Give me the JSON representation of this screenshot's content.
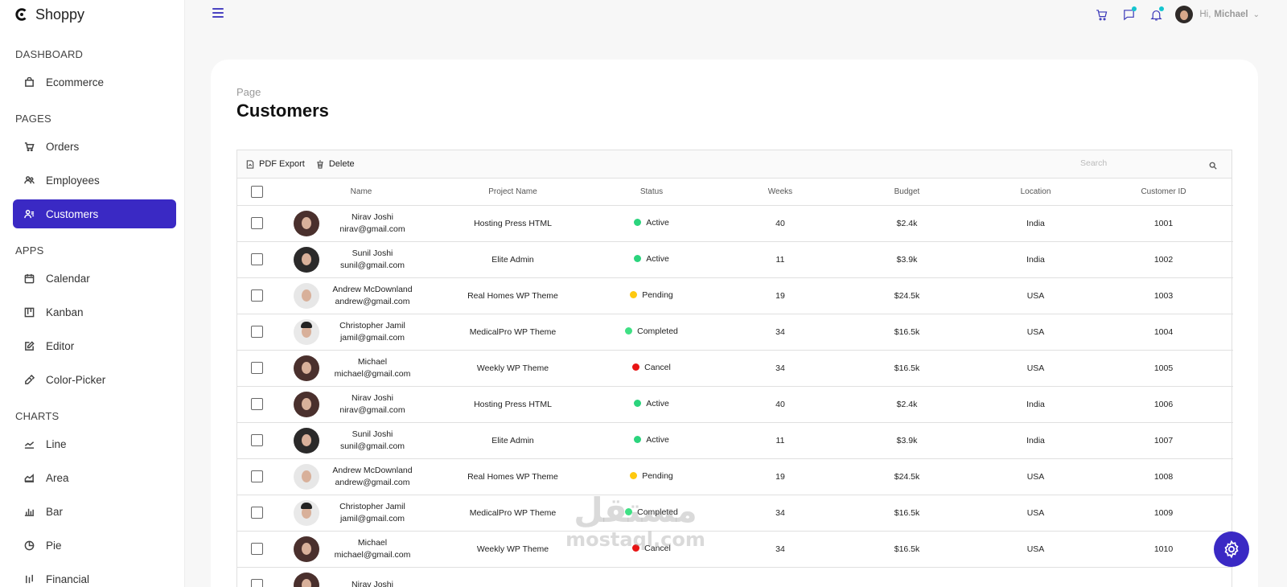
{
  "app": {
    "name": "Shoppy"
  },
  "sidebar": {
    "sections": [
      {
        "title": "DASHBOARD",
        "items": [
          {
            "label": "Ecommerce",
            "icon": "shopping-bag-icon"
          }
        ]
      },
      {
        "title": "PAGES",
        "items": [
          {
            "label": "Orders",
            "icon": "cart-icon"
          },
          {
            "label": "Employees",
            "icon": "employees-icon"
          },
          {
            "label": "Customers",
            "icon": "customers-icon",
            "active": true
          }
        ]
      },
      {
        "title": "APPS",
        "items": [
          {
            "label": "Calendar",
            "icon": "calendar-icon"
          },
          {
            "label": "Kanban",
            "icon": "kanban-icon"
          },
          {
            "label": "Editor",
            "icon": "edit-icon"
          },
          {
            "label": "Color-Picker",
            "icon": "color-picker-icon"
          }
        ]
      },
      {
        "title": "CHARTS",
        "items": [
          {
            "label": "Line",
            "icon": "line-chart-icon"
          },
          {
            "label": "Area",
            "icon": "area-chart-icon"
          },
          {
            "label": "Bar",
            "icon": "bar-chart-icon"
          },
          {
            "label": "Pie",
            "icon": "pie-chart-icon"
          },
          {
            "label": "Financial",
            "icon": "financial-icon"
          }
        ]
      }
    ]
  },
  "topbar": {
    "greeting": "Hi,",
    "user_name": "Michael",
    "accent": "#3a38b8",
    "notification_dot_color": "#14c5cf"
  },
  "page": {
    "subtitle": "Page",
    "title": "Customers"
  },
  "grid": {
    "toolbar": {
      "pdf_export": "PDF Export",
      "delete": "Delete"
    },
    "search": {
      "placeholder": "Search"
    },
    "columns": [
      "Name",
      "Project Name",
      "Status",
      "Weeks",
      "Budget",
      "Location",
      "Customer ID"
    ],
    "status_colors": {
      "Active": "#2bd47d",
      "Pending": "#fec90f",
      "Completed": "#3fe084",
      "Cancel": "#e81414"
    },
    "rows": [
      {
        "name": "Nirav Joshi",
        "email": "nirav@gmail.com",
        "project": "Hosting Press HTML",
        "status": "Active",
        "weeks": "40",
        "budget": "$2.4k",
        "location": "India",
        "id": "1001",
        "avatar": "av-a"
      },
      {
        "name": "Sunil Joshi",
        "email": "sunil@gmail.com",
        "project": "Elite Admin",
        "status": "Active",
        "weeks": "11",
        "budget": "$3.9k",
        "location": "India",
        "id": "1002",
        "avatar": "av-b"
      },
      {
        "name": "Andrew McDownland",
        "email": "andrew@gmail.com",
        "project": "Real Homes WP Theme",
        "status": "Pending",
        "weeks": "19",
        "budget": "$24.5k",
        "location": "USA",
        "id": "1003",
        "avatar": "av-c"
      },
      {
        "name": "Christopher Jamil",
        "email": "jamil@gmail.com",
        "project": "MedicalPro WP Theme",
        "status": "Completed",
        "weeks": "34",
        "budget": "$16.5k",
        "location": "USA",
        "id": "1004",
        "avatar": "av-d"
      },
      {
        "name": "Michael",
        "email": "michael@gmail.com",
        "project": "Weekly WP Theme",
        "status": "Cancel",
        "weeks": "34",
        "budget": "$16.5k",
        "location": "USA",
        "id": "1005",
        "avatar": "av-a"
      },
      {
        "name": "Nirav Joshi",
        "email": "nirav@gmail.com",
        "project": "Hosting Press HTML",
        "status": "Active",
        "weeks": "40",
        "budget": "$2.4k",
        "location": "India",
        "id": "1006",
        "avatar": "av-a"
      },
      {
        "name": "Sunil Joshi",
        "email": "sunil@gmail.com",
        "project": "Elite Admin",
        "status": "Active",
        "weeks": "11",
        "budget": "$3.9k",
        "location": "India",
        "id": "1007",
        "avatar": "av-b"
      },
      {
        "name": "Andrew McDownland",
        "email": "andrew@gmail.com",
        "project": "Real Homes WP Theme",
        "status": "Pending",
        "weeks": "19",
        "budget": "$24.5k",
        "location": "USA",
        "id": "1008",
        "avatar": "av-c"
      },
      {
        "name": "Christopher Jamil",
        "email": "jamil@gmail.com",
        "project": "MedicalPro WP Theme",
        "status": "Completed",
        "weeks": "34",
        "budget": "$16.5k",
        "location": "USA",
        "id": "1009",
        "avatar": "av-d"
      },
      {
        "name": "Michael",
        "email": "michael@gmail.com",
        "project": "Weekly WP Theme",
        "status": "Cancel",
        "weeks": "34",
        "budget": "$16.5k",
        "location": "USA",
        "id": "1010",
        "avatar": "av-a"
      },
      {
        "name": "Nirav Joshi",
        "email": "",
        "project": "",
        "status": "",
        "weeks": "",
        "budget": "",
        "location": "",
        "id": "",
        "avatar": "av-a"
      }
    ]
  },
  "watermark": {
    "arabic": "مستقل",
    "latin": "mostaql.com"
  },
  "theme": {
    "primary": "#3a29c4"
  }
}
